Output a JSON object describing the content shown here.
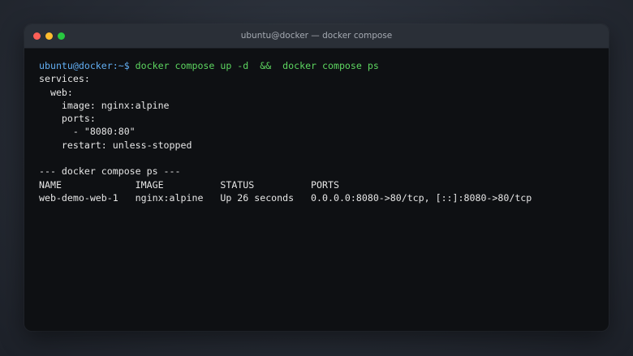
{
  "window": {
    "title": "ubuntu@docker — docker compose"
  },
  "terminal": {
    "prompt": {
      "user_host": "ubuntu@docker",
      "path": ":~$ ",
      "command": "docker compose up -d  &&  docker compose ps"
    },
    "lines": [
      "services:",
      "  web:",
      "    image: nginx:alpine",
      "    ports:",
      "      - \"8080:80\"",
      "    restart: unless-stopped",
      "",
      "--- docker compose ps ---"
    ],
    "ps_table": {
      "header": "NAME             IMAGE          STATUS          PORTS",
      "rows": [
        "web-demo-web-1   nginx:alpine   Up 26 seconds   0.0.0.0:8080->80/tcp, [::]:8080->80/tcp"
      ]
    }
  },
  "colors": {
    "prompt": "#62aef2",
    "command": "#5dd660",
    "output": "#e6e6e6",
    "background": "#0e1013",
    "titlebar": "#2a2f37",
    "close": "#fe5f57",
    "minimize": "#febc2e",
    "zoom": "#28c840"
  }
}
